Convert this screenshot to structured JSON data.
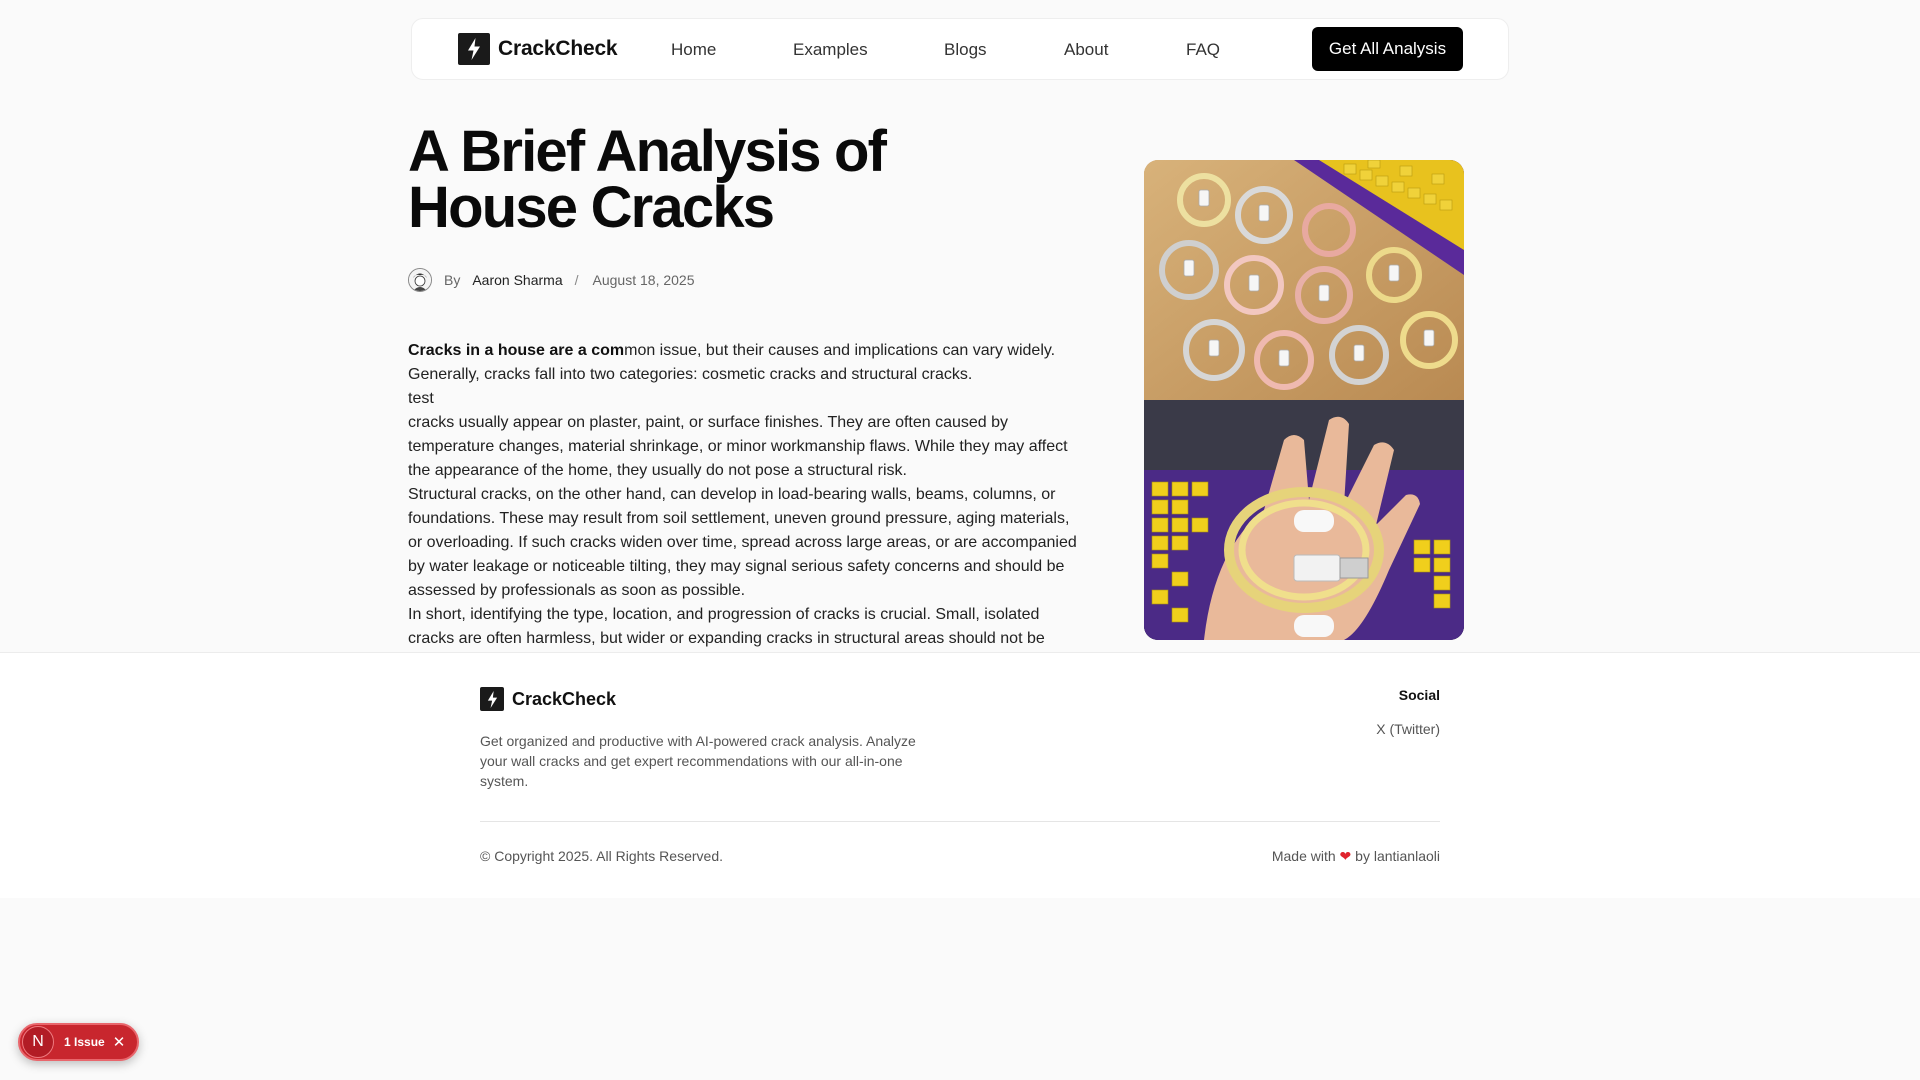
{
  "nav": {
    "brand": "CrackCheck",
    "links": [
      "Home",
      "Examples",
      "Blogs",
      "About",
      "FAQ"
    ],
    "cta": "Get All Analysis"
  },
  "article": {
    "title_line1": "A Brief Analysis of",
    "title_line2": "House Cracks",
    "by": "By",
    "author": "Aaron Sharma",
    "separator": "/",
    "date": "August 18, 2025",
    "p1_bold": "Cracks in a house are a com",
    "p1_rest": "mon issue, but their causes and implications can vary widely. Generally, cracks fall into two categories: cosmetic cracks and structural cracks.",
    "p2": "test",
    "p3": "cracks usually appear on plaster, paint, or surface finishes. They are often caused by temperature changes, material shrinkage, or minor workmanship flaws. While they may affect the appearance of the home, they usually do not pose a structural risk.",
    "p4": "Structural cracks, on the other hand, can develop in load-bearing walls, beams, columns, or foundations. These may result from soil settlement, uneven ground pressure, aging materials, or overloading. If such cracks widen over time, spread across large areas, or are accompanied by water leakage or noticeable tilting, they may signal serious safety concerns and should be assessed by professionals as soon as possible.",
    "p5": "In short, identifying the type, location, and progression of cracks is crucial. Small, isolated cracks are often harmless, but wider or expanding cracks in structural areas should not be ignored."
  },
  "footer": {
    "brand": "CrackCheck",
    "description": "Get organized and productive with AI-powered crack analysis. Analyze your wall cracks and get expert recommendations with our all-in-one system.",
    "social_title": "Social",
    "social_link": "X (Twitter)",
    "copyright": "© Copyright 2025. All Rights Reserved.",
    "made_prefix": "Made with",
    "made_heart": "❤",
    "made_suffix": "by lantianlaoli"
  },
  "issue_badge": {
    "letter": "N",
    "text": "1 Issue",
    "close": "✕"
  },
  "icons": {
    "brand_logo": "lightning-bolt-icon",
    "close": "close-icon"
  },
  "colors": {
    "cta_bg": "#000000",
    "heart": "#e0242e",
    "issue_badge": "#c8262e"
  }
}
